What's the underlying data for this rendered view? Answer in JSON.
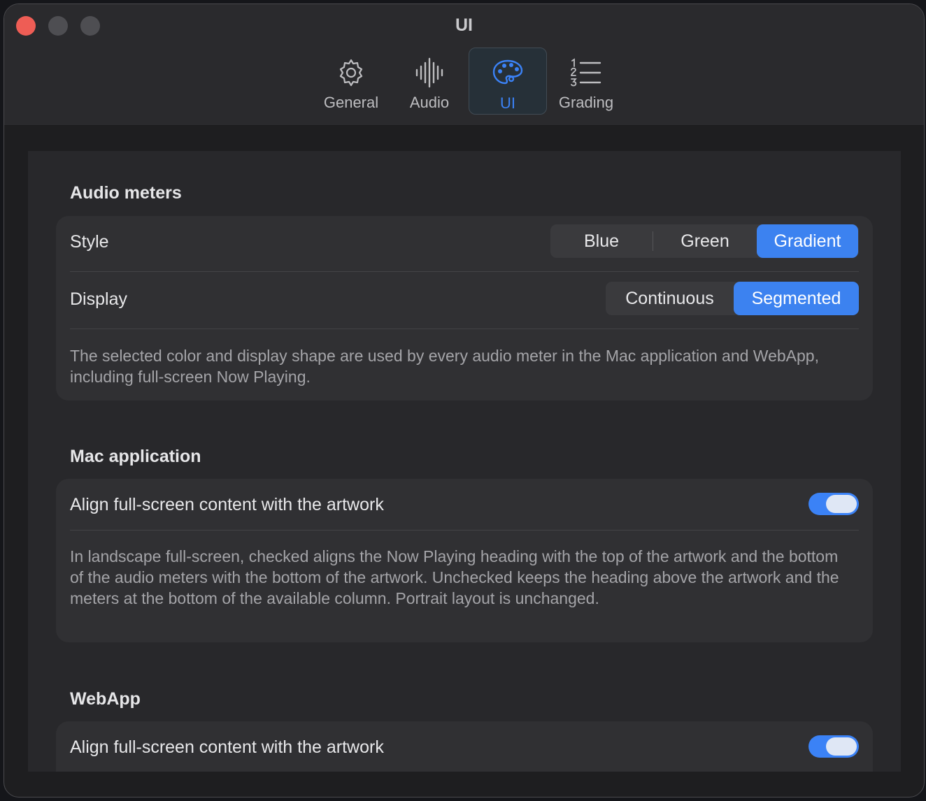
{
  "window": {
    "title": "UI"
  },
  "toolbar": {
    "items": [
      {
        "label": "General",
        "icon": "gear-icon",
        "active": false
      },
      {
        "label": "Audio",
        "icon": "waveform-icon",
        "active": false
      },
      {
        "label": "UI",
        "icon": "palette-icon",
        "active": true
      },
      {
        "label": "Grading",
        "icon": "numbered-list-icon",
        "active": false
      }
    ]
  },
  "audio_meters": {
    "title": "Audio meters",
    "style_label": "Style",
    "style_options": [
      "Blue",
      "Green",
      "Gradient"
    ],
    "style_selected": "Gradient",
    "display_label": "Display",
    "display_options": [
      "Continuous",
      "Segmented"
    ],
    "display_selected": "Segmented",
    "help": "The selected color and display shape are used by every audio meter in the Mac application and WebApp, including full-screen Now Playing."
  },
  "mac_application": {
    "title": "Mac application",
    "align_label": "Align full-screen content with the artwork",
    "align_enabled": true,
    "help": "In landscape full-screen, checked aligns the Now Playing heading with the top of the artwork and the bottom of the audio meters with the bottom of the artwork. Unchecked keeps the heading above the artwork and the meters at the bottom of the available column. Portrait layout is unchanged."
  },
  "webapp": {
    "title": "WebApp",
    "align_label": "Align full-screen content with the artwork",
    "align_enabled": true
  },
  "colors": {
    "accent": "#3b82f6",
    "close_button": "#ee5d55",
    "window_background": "#1e1e20",
    "card_background": "#303033"
  }
}
